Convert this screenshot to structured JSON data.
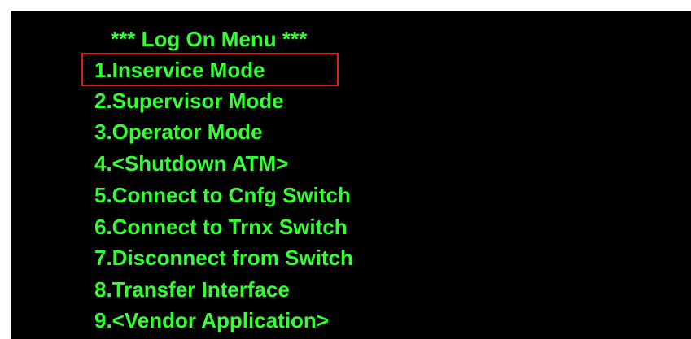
{
  "menu": {
    "title": "*** Log On Menu ***",
    "selected_index": 0,
    "items": [
      {
        "label": "1.Inservice Mode"
      },
      {
        "label": "2.Supervisor Mode"
      },
      {
        "label": "3.Operator Mode"
      },
      {
        "label": "4.<Shutdown ATM>"
      },
      {
        "label": "5.Connect to Cnfg Switch"
      },
      {
        "label": "6.Connect to Trnx Switch"
      },
      {
        "label": "7.Disconnect from Switch"
      },
      {
        "label": "8.Transfer Interface"
      },
      {
        "label": "9.<Vendor Application>"
      }
    ]
  },
  "colors": {
    "background": "#000000",
    "text": "#33ff33",
    "selection_border": "#e21b1b"
  }
}
